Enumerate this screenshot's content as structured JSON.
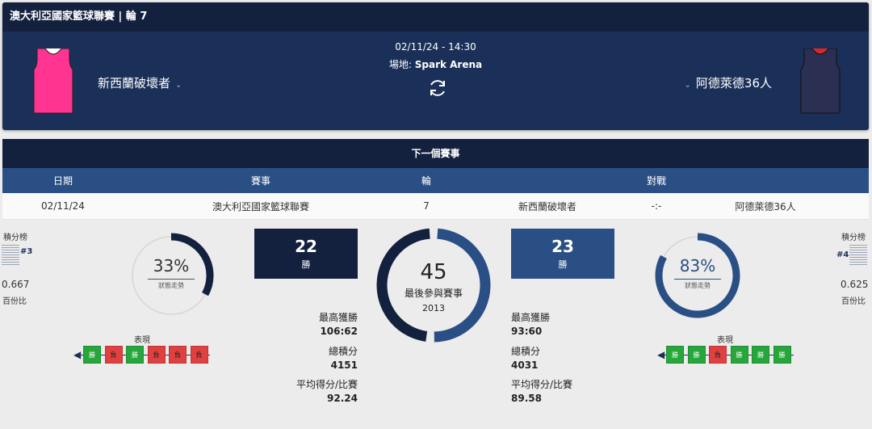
{
  "header": {
    "title": "澳大利亞國家籃球聯賽 | 輪 7"
  },
  "match": {
    "datetime": "02/11/24 - 14:30",
    "venue_label": "場地: ",
    "venue_value": "Spark Arena",
    "home_team": "新西蘭破壞者",
    "away_team": "阿德萊德36人"
  },
  "colors": {
    "home_jersey": "#ff3390",
    "away_jersey": "#2b2f52",
    "away_trim": "#d7262e",
    "navy": "#13203e",
    "blue": "#2a4f85"
  },
  "next": {
    "header": "下一個賽事",
    "columns": [
      "日期",
      "賽事",
      "輪",
      "對戰"
    ],
    "row": {
      "date": "02/11/24",
      "competition": "澳大利亞國家籃球聯賽",
      "round": "7",
      "home": "新西蘭破壞者",
      "score": "-:-",
      "away": "阿德萊德36人"
    }
  },
  "home": {
    "standings_label": "積分榜",
    "rank": "#3",
    "pct_value": "0.667",
    "pct_label": "百份比",
    "form_pct": "33%",
    "form_pct_value": 0.33,
    "form_sub": "狀態走勢",
    "form_label": "表現",
    "form": [
      "勝",
      "負",
      "勝",
      "負",
      "負",
      "負"
    ],
    "wins": "22",
    "wins_label": "勝",
    "stats": [
      {
        "label": "最高獲勝",
        "value": "106:62"
      },
      {
        "label": "總積分",
        "value": "4151"
      },
      {
        "label": "平均得分/比賽",
        "value": "92.24"
      }
    ]
  },
  "away": {
    "standings_label": "積分榜",
    "rank": "#4",
    "pct_value": "0.625",
    "pct_label": "百份比",
    "form_pct": "83%",
    "form_pct_value": 0.83,
    "form_sub": "狀態走勢",
    "form_label": "表現",
    "form": [
      "勝",
      "勝",
      "負",
      "勝",
      "勝",
      "勝"
    ],
    "wins": "23",
    "wins_label": "勝",
    "stats": [
      {
        "label": "最高獲勝",
        "value": "93:60"
      },
      {
        "label": "總積分",
        "value": "4031"
      },
      {
        "label": "平均得分/比賽",
        "value": "89.58"
      }
    ]
  },
  "h2h": {
    "total": "45",
    "total_label": "最後參與賽事",
    "since": "2013",
    "home_share": 0.49
  }
}
